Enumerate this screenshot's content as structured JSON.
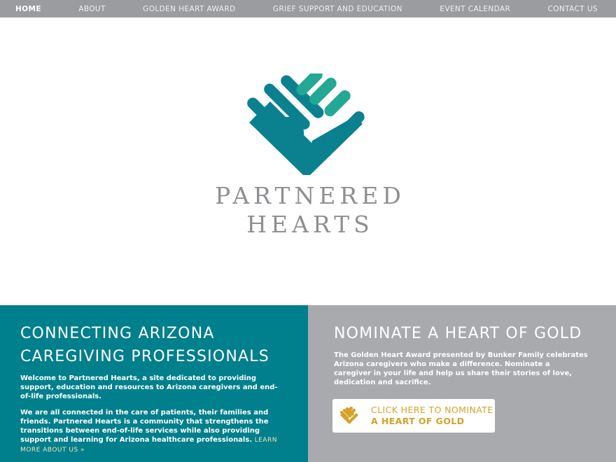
{
  "nav": {
    "items": [
      {
        "label": "HOME",
        "active": true
      },
      {
        "label": "ABOUT",
        "active": false
      },
      {
        "label": "GOLDEN HEART AWARD",
        "active": false
      },
      {
        "label": "GRIEF SUPPORT AND EDUCATION",
        "active": false
      },
      {
        "label": "EVENT CALENDAR",
        "active": false
      },
      {
        "label": "CONTACT US",
        "active": false
      }
    ]
  },
  "hero": {
    "logo_icon": "hands-heart-logo-icon",
    "brand_line1": "PARTNERED",
    "brand_line2": "HEARTS"
  },
  "left_panel": {
    "heading_line1": "CONNECTING ARIZONA",
    "heading_line2": "CAREGIVING PROFESSIONALS",
    "paragraph1": "Welcome to Partnered Hearts, a site dedicated to providing support, education and resources to Arizona caregivers and end-of-life professionals.",
    "paragraph2": "We are all connected in the care of patients, their families and friends. Partnered Hearts is a community that strengthens the transitions between end-of-life services while also providing support and learning for Arizona healthcare professionals.",
    "learn_more": "LEARN MORE ABOUT US",
    "learn_more_suffix": "»"
  },
  "right_panel": {
    "heading": "NOMINATE A HEART OF GOLD",
    "paragraph": "The Golden Heart Award presented by Bunker Family celebrates Arizona caregivers who make a difference. Nominate a caregiver in your life and help us share their stories of love, dedication and sacrifice.",
    "button_line1": "CLICK HERE TO NOMINATE",
    "button_line2": "A HEART OF GOLD",
    "button_icon": "gold-hands-heart-icon"
  },
  "colors": {
    "nav_bg": "#9a9ca0",
    "teal": "#007f8c",
    "teal_light": "#22a894",
    "gray_panel": "#a9aaae",
    "gold": "#d3a229"
  }
}
